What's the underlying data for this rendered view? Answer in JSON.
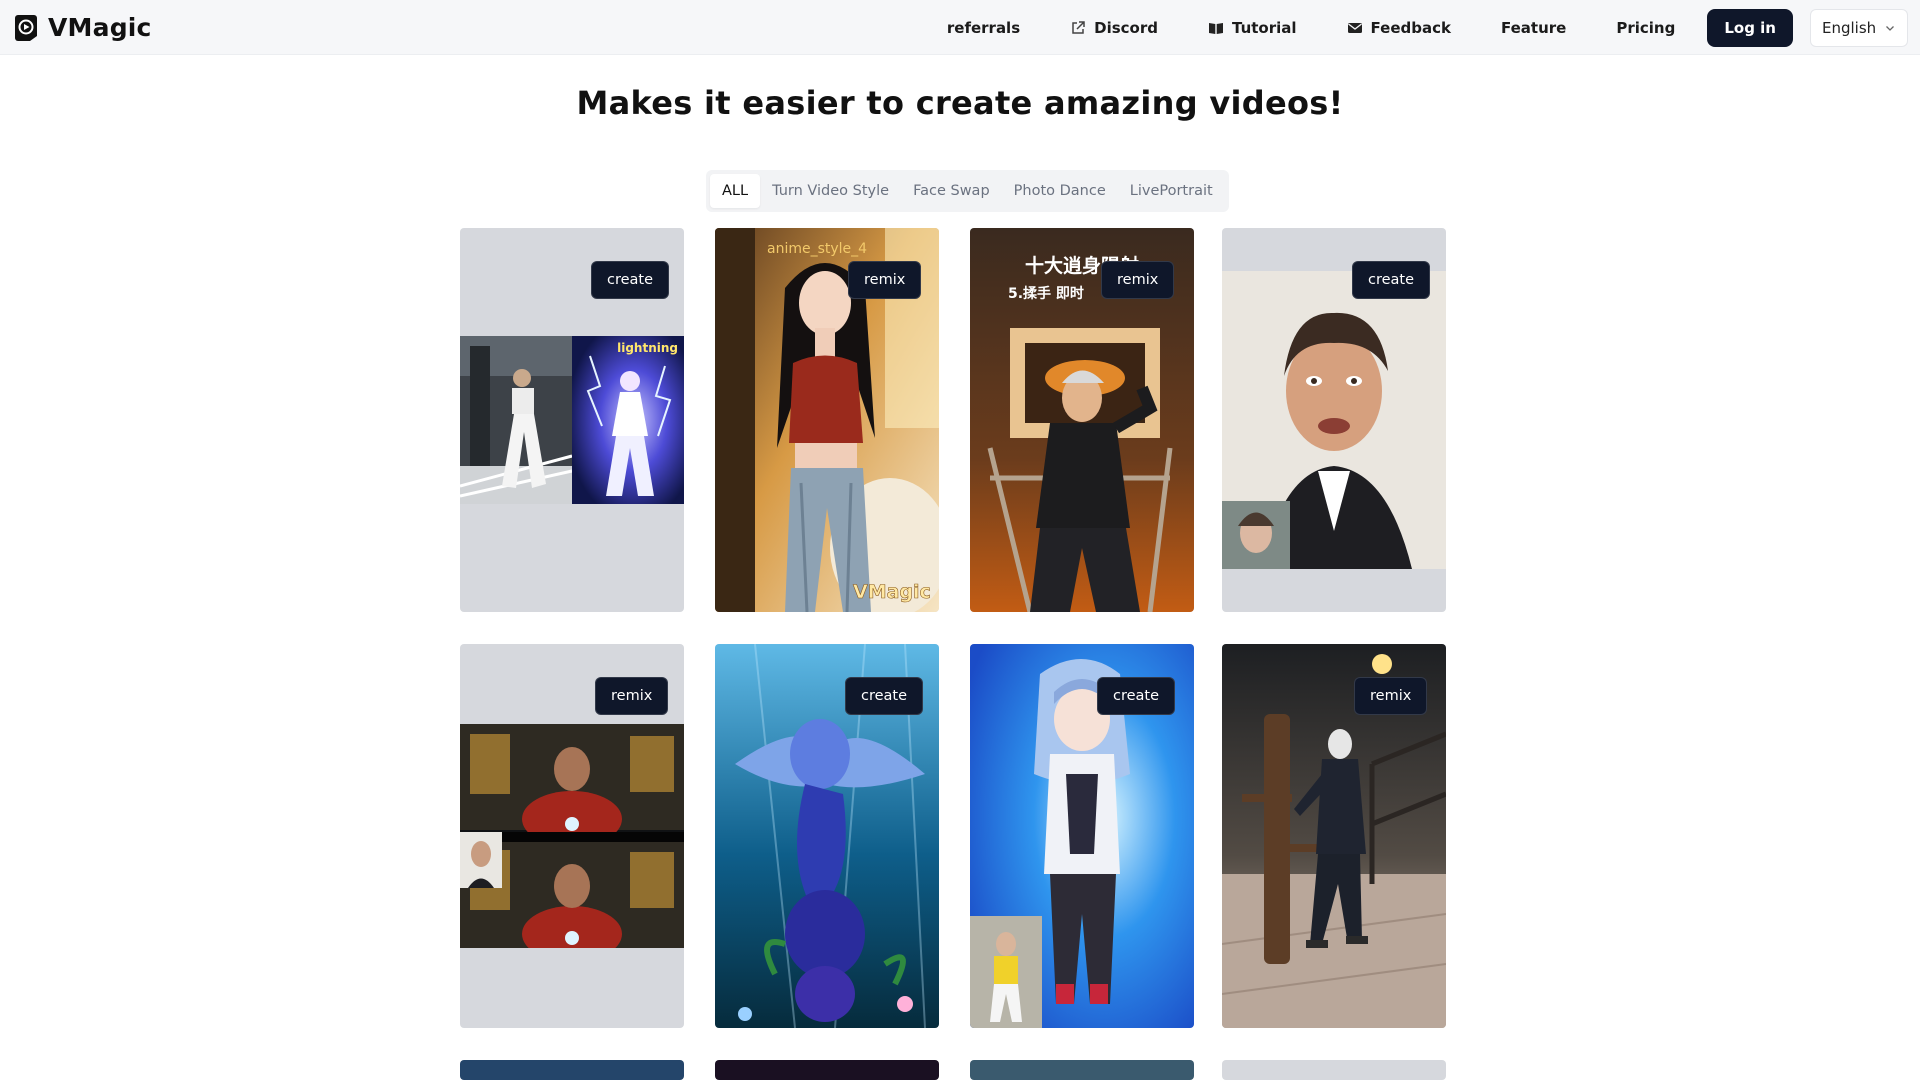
{
  "brand": {
    "name": "VMagic"
  },
  "nav": {
    "referrals": "referrals",
    "discord": "Discord",
    "tutorial": "Tutorial",
    "feedback": "Feedback",
    "feature": "Feature",
    "pricing": "Pricing",
    "login": "Log in",
    "language": "English"
  },
  "page_title": "Makes it easier to create amazing videos!",
  "tabs": [
    {
      "label": "ALL",
      "active": true
    },
    {
      "label": "Turn Video Style",
      "active": false
    },
    {
      "label": "Face Swap",
      "active": false
    },
    {
      "label": "Photo Dance",
      "active": false
    },
    {
      "label": "LivePortrait",
      "active": false
    }
  ],
  "cards": [
    {
      "button": "create",
      "overlay": "lightning"
    },
    {
      "button": "remix",
      "overlay": "anime_style_4",
      "watermark": "VMagic"
    },
    {
      "button": "remix",
      "overlay": "十大逍身陽射",
      "overlay2": "5.揉手 即时"
    },
    {
      "button": "create"
    },
    {
      "button": "remix"
    },
    {
      "button": "create"
    },
    {
      "button": "create"
    },
    {
      "button": "remix"
    }
  ],
  "icons": {
    "logo": "vmagic-logo-icon",
    "discord": "external-link-icon",
    "tutorial": "book-icon",
    "feedback": "envelope-icon",
    "language": "chevron-down-icon"
  },
  "colors": {
    "primary": "#0f172a",
    "header_bg": "#f6f7f9",
    "card_bg": "#d6d8dd"
  }
}
